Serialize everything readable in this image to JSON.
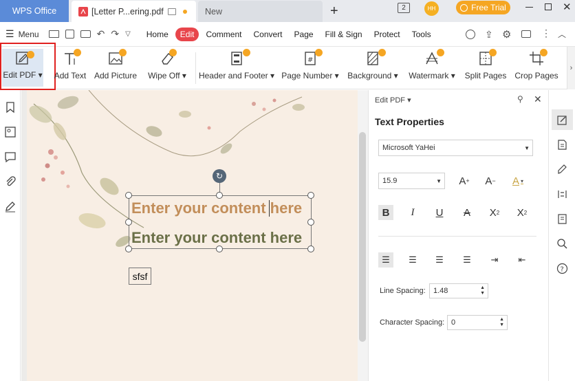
{
  "titlebar": {
    "tabs": [
      {
        "label": "WPS Office"
      },
      {
        "label": "[Letter P...ering.pdf"
      },
      {
        "label": "New"
      }
    ],
    "window_count": "2",
    "avatar_initials": "HH",
    "free_trial_label": "Free Trial"
  },
  "menubar": {
    "menu_label": "Menu",
    "items": [
      "Home",
      "Edit",
      "Comment",
      "Convert",
      "Page",
      "Fill & Sign",
      "Protect",
      "Tools"
    ]
  },
  "ribbon": {
    "edit_pdf": "Edit PDF",
    "add_text": "Add Text",
    "add_picture": "Add Picture",
    "wipe_off": "Wipe Off",
    "header_footer": "Header and Footer",
    "page_number": "Page Number",
    "background": "Background",
    "watermark": "Watermark",
    "split_pages": "Split Pages",
    "crop_pages": "Crop Pages"
  },
  "document": {
    "line1": "Enter your content here",
    "line2": "Enter your content here",
    "small_box": "sfsf"
  },
  "panel": {
    "header": "Edit PDF",
    "title": "Text Properties",
    "font_name": "Microsoft YaHei",
    "font_size": "15.9",
    "line_spacing_label": "Line Spacing:",
    "line_spacing_value": "1.48",
    "char_spacing_label": "Character Spacing:",
    "char_spacing_value": "0"
  },
  "colors": {
    "accent_red": "#e8454b",
    "highlight_box": "#e0201f",
    "text_line1": "#c28e5a",
    "text_line2": "#6b7048",
    "wps_tab": "#5b8bd8",
    "free_trial": "#f5a623"
  }
}
